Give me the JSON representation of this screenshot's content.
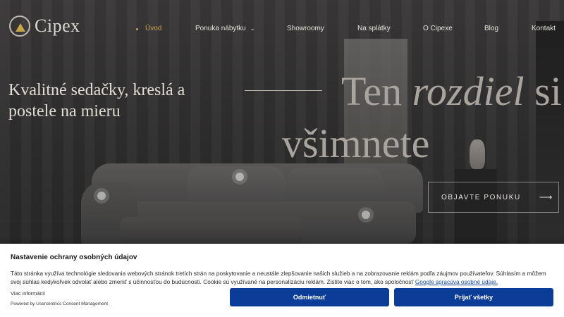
{
  "brand": {
    "name": "Cipex",
    "logo_icon": "crown-logo-icon"
  },
  "nav": {
    "items": [
      {
        "label": "Úvod",
        "active": true
      },
      {
        "label": "Ponuka nábytku",
        "has_dropdown": true
      },
      {
        "label": "Showroomy"
      },
      {
        "label": "Na splátky"
      },
      {
        "label": "O Cipexe"
      },
      {
        "label": "Blog"
      },
      {
        "label": "Kontakt"
      }
    ],
    "dropdown_icon": "chevron-down-icon"
  },
  "hero": {
    "subtitle": "Kvalitné sedačky, kreslá a postele na mieru",
    "headline_part1": "Ten ",
    "headline_emphasis": "rozdiel",
    "headline_part2": " si",
    "headline_line2": "všimnete",
    "cta_label": "OBJAVTE PONUKU",
    "cta_icon": "arrow-right-icon"
  },
  "consent": {
    "title": "Nastavenie ochrany osobných údajov",
    "text": "Táto stránka využíva technológie sledovania webových stránok tretích strán na poskytovanie a neustále zlepšovanie našich služieb a na zobrazovanie reklám podľa záujmov používateľov. Súhlasím a môžem svoj súhlas kedykoľvek odvolať alebo zmeniť s účinnosťou do budúcnosti. Cookie sú využívané na personalizáciu reklám. Zistite viac o tom, ako spoločnosť ",
    "link_text": "Google spracúva osobné údaje.",
    "more_info": "Viac informácií",
    "powered_by": "Powered by Usercentrics Consent Management",
    "deny_label": "Odmietnuť",
    "accept_label": "Prijať všetky",
    "button_color": "#0b3d98"
  },
  "colors": {
    "accent_gold": "#c9a54a",
    "hero_text": "#e2ddd5"
  }
}
